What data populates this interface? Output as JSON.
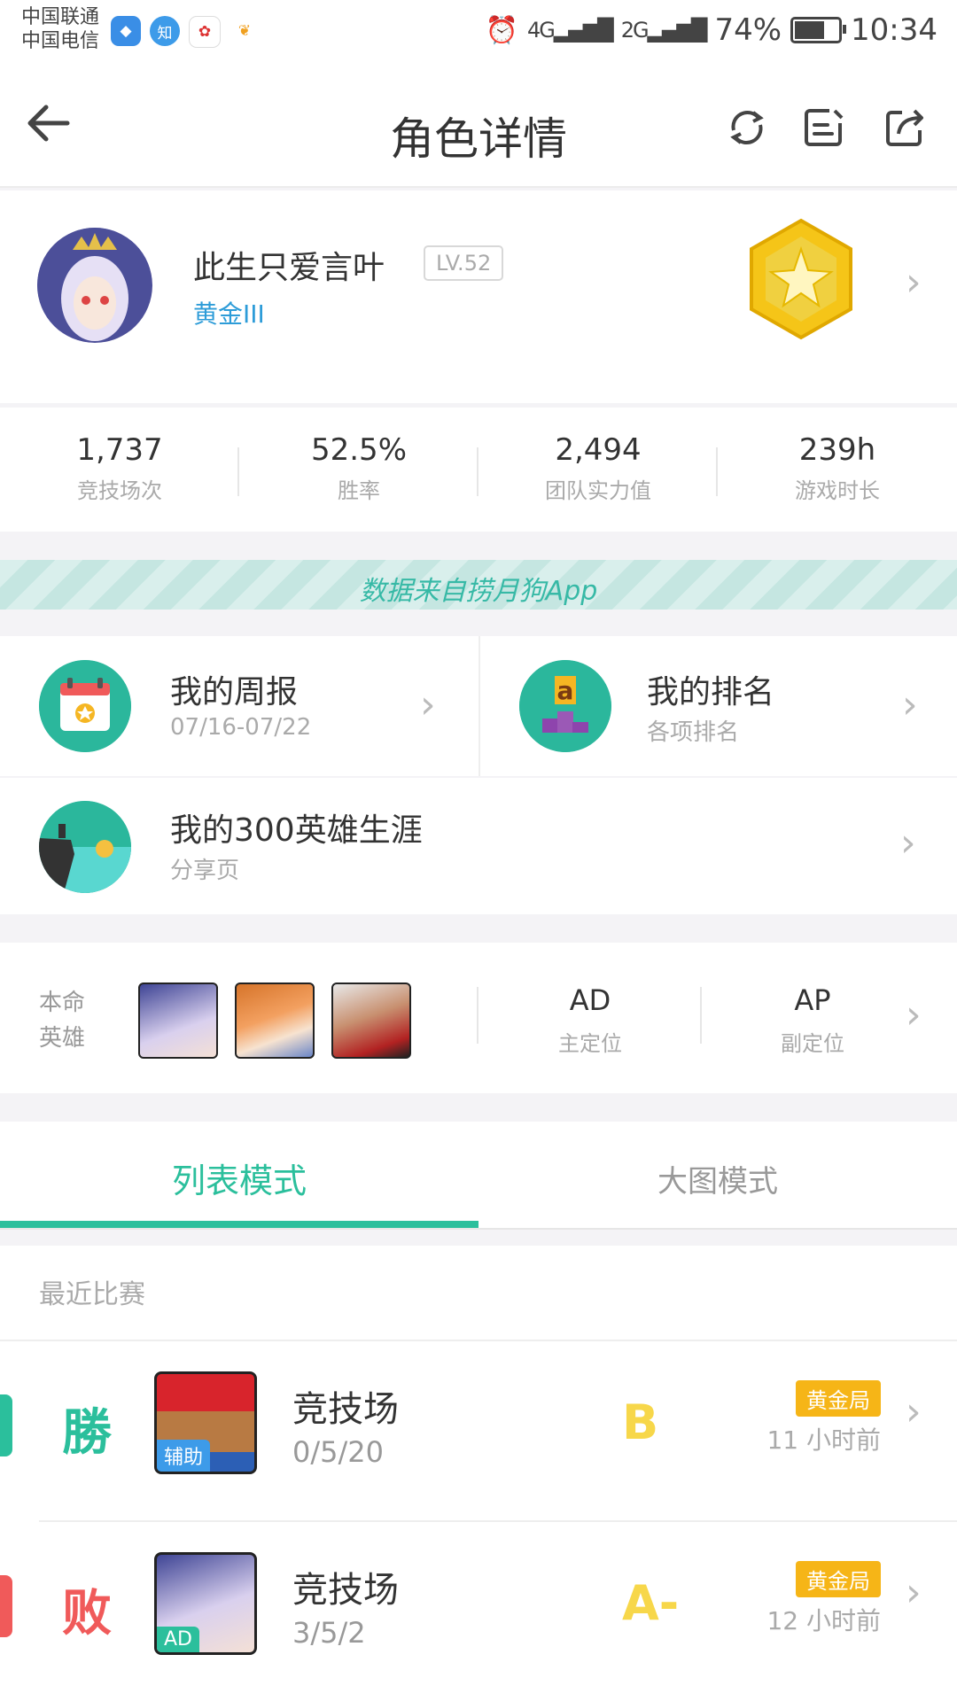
{
  "status": {
    "carrier1": "中国联通",
    "carrier2": "中国电信",
    "app_badge": "知",
    "signal1": "4G",
    "signal2": "2G",
    "battery": "74%",
    "battery_level": 0.74,
    "time": "10:34"
  },
  "header": {
    "title": "角色详情"
  },
  "profile": {
    "name": "此生只爱言叶",
    "level": "LV.52",
    "rank": "黄金III"
  },
  "stats": [
    {
      "value": "1,737",
      "label": "竞技场次"
    },
    {
      "value": "52.5%",
      "label": "胜率"
    },
    {
      "value": "2,494",
      "label": "团队实力值"
    },
    {
      "value": "239h",
      "label": "游戏时长"
    }
  ],
  "banner": "数据来自捞月狗App",
  "features": {
    "weekly": {
      "title": "我的周报",
      "sub": "07/16-07/22"
    },
    "ranking": {
      "title": "我的排名",
      "sub": "各项排名"
    },
    "career": {
      "title": "我的300英雄生涯",
      "sub": "分享页"
    }
  },
  "heroes": {
    "label1": "本命",
    "label2": "英雄",
    "main_pos": "AD",
    "main_pos_label": "主定位",
    "sub_pos": "AP",
    "sub_pos_label": "副定位"
  },
  "tabs": {
    "list": "列表模式",
    "grid": "大图模式"
  },
  "recent": {
    "heading": "最近比赛",
    "matches": [
      {
        "result": "勝",
        "role": "辅助",
        "mode": "竞技场",
        "kda": "0/5/20",
        "grade": "B",
        "tier": "黄金局",
        "ago": "11 小时前"
      },
      {
        "result": "败",
        "role": "AD",
        "mode": "竞技场",
        "kda": "3/5/2",
        "grade": "A-",
        "tier": "黄金局",
        "ago": "12 小时前"
      }
    ]
  },
  "colors": {
    "accent": "#2bbf9c",
    "win": "#2bbf9c",
    "loss": "#f05a5a",
    "rank": "#2d9cd8",
    "gold": "#f6b517"
  }
}
